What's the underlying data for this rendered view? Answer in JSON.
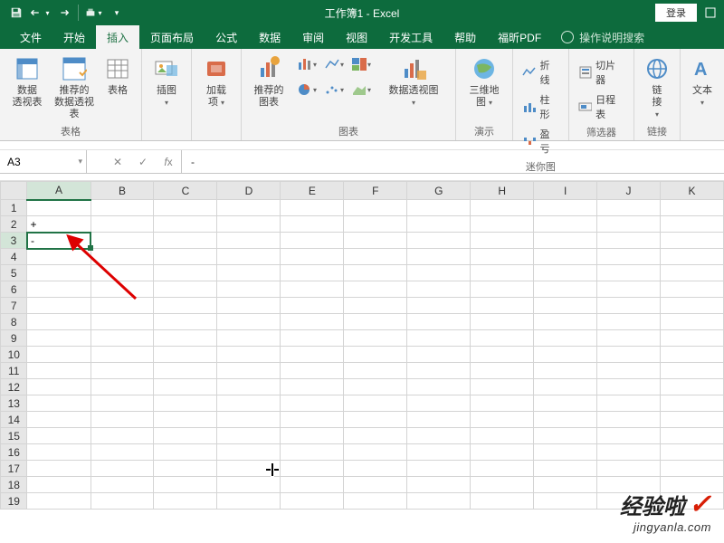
{
  "title": "工作簿1 - Excel",
  "login": "登录",
  "qat": {
    "save": "save",
    "undo": "undo",
    "redo": "redo",
    "quickprint": "quick-print"
  },
  "tabs": [
    "文件",
    "开始",
    "插入",
    "页面布局",
    "公式",
    "数据",
    "审阅",
    "视图",
    "开发工具",
    "帮助",
    "福昕PDF"
  ],
  "active_tab_index": 2,
  "tell_me": "操作说明搜索",
  "ribbon": {
    "tables": {
      "pivot": "数据\n透视表",
      "rec_pivot": "推荐的\n数据透视表",
      "table": "表格",
      "label": "表格"
    },
    "illus": {
      "illus": "插图",
      "label": ""
    },
    "addins": {
      "addins": "加载\n项",
      "label": ""
    },
    "charts": {
      "rec": "推荐的\n图表",
      "pivotchart": "数据透视图",
      "label": "图表"
    },
    "demo": {
      "map": "三维地\n图",
      "label": "演示"
    },
    "spark": {
      "line": "折线",
      "column": "柱形",
      "winloss": "盈亏",
      "label": "迷你图"
    },
    "filter": {
      "slicer": "切片器",
      "timeline": "日程表",
      "label": "筛选器"
    },
    "link": {
      "link": "链\n接",
      "label": "链接"
    },
    "text": {
      "text": "文本",
      "label": ""
    }
  },
  "namebox": "A3",
  "formula": "-",
  "columns": [
    "A",
    "B",
    "C",
    "D",
    "E",
    "F",
    "G",
    "H",
    "I",
    "J",
    "K"
  ],
  "rows_count": 19,
  "selected_col": 0,
  "selected_row": 2,
  "cells": {
    "A2": "+",
    "A3": "-"
  },
  "watermark": {
    "main": "经验啦",
    "sub": "jingyanla.com"
  }
}
